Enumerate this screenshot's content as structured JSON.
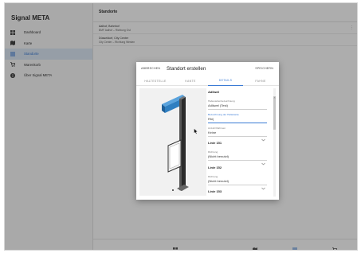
{
  "app": {
    "title": "Signal META"
  },
  "sidebar": {
    "items": [
      {
        "label": "Dashboard",
        "icon": "dashboard-icon"
      },
      {
        "label": "Karte",
        "icon": "map-icon"
      },
      {
        "label": "Standorte",
        "icon": "list-icon",
        "active": true
      },
      {
        "label": "Warenkorb",
        "icon": "cart-icon"
      },
      {
        "label": "Über Signal META",
        "icon": "info-icon"
      }
    ]
  },
  "main": {
    "page_title": "Standorte",
    "locations": [
      {
        "name": "Aalhof, Bahnhof",
        "sub": "BMF Aalhof – Richtung Ost"
      },
      {
        "name": "Düsseldorf, City Center",
        "sub": "City Center – Richtung Westen"
      }
    ]
  },
  "dialog": {
    "cancel": "ABBRECHEN",
    "title": "Standort erstellen",
    "save": "SPEICHERN",
    "tabs": [
      "HALTESTELLE",
      "KANTE",
      "DETAILS",
      "FAHNE"
    ],
    "active_tab": "DETAILS",
    "form": {
      "section1_title": "Adlkwi/",
      "field1_label": "Haltestellenbezeichnung",
      "field1_value": "Adlkwel (Test)",
      "field2_label": "Bezeichnung der Haltekante",
      "field2_value": "Rhi|",
      "field3_label": "Anzahl Rahmen",
      "field3_value": "Keine",
      "line1_title": "Linie 151",
      "line1_field_label": "Richtung",
      "line1_field_value": "(Nicht benutzt)",
      "line2_title": "Linie 152",
      "line2_field_label": "Richtung",
      "line2_field_value": "(Nicht benutzt)",
      "line3_title": "Linie 153"
    }
  },
  "colors": {
    "accent": "#3a7bd5",
    "overlay": "rgba(0,0,0,0.32)",
    "sign_blue": "#2f7fc1"
  }
}
